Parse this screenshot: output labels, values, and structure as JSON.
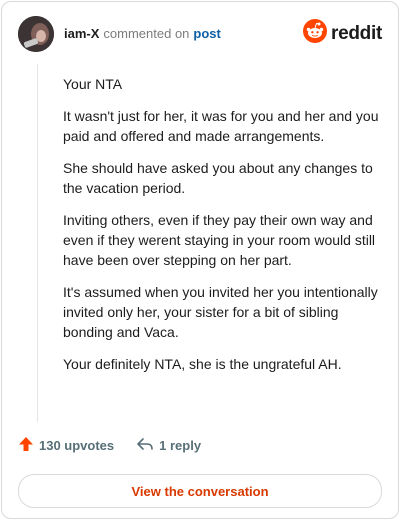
{
  "comment": {
    "username": "iam-X",
    "commented_text": "commented on",
    "post_link": "post",
    "paragraphs": [
      "Your NTA",
      "It wasn't just for her, it was for you and her and you paid and offered and made arrangements.",
      "She should have asked you about any changes to the vacation period.",
      "Inviting others, even if they pay their own way and even if they werent staying in your room would still have been over stepping on her part.",
      "It's assumed when you invited her you intentionally invited only her, your sister for a bit of sibling bonding and Vaca.",
      "Your definitely NTA, she is the ungrateful AH."
    ],
    "upvotes": "130 upvotes",
    "replies": "1 reply"
  },
  "branding": {
    "wordmark": "reddit",
    "accent": "#ff4500"
  },
  "cta": {
    "label": "View the conversation",
    "color": "#d93900"
  },
  "icons": {
    "upvote": "arrow-up-icon",
    "reply": "reply-arrow-icon",
    "logo": "reddit-snoo-icon"
  }
}
